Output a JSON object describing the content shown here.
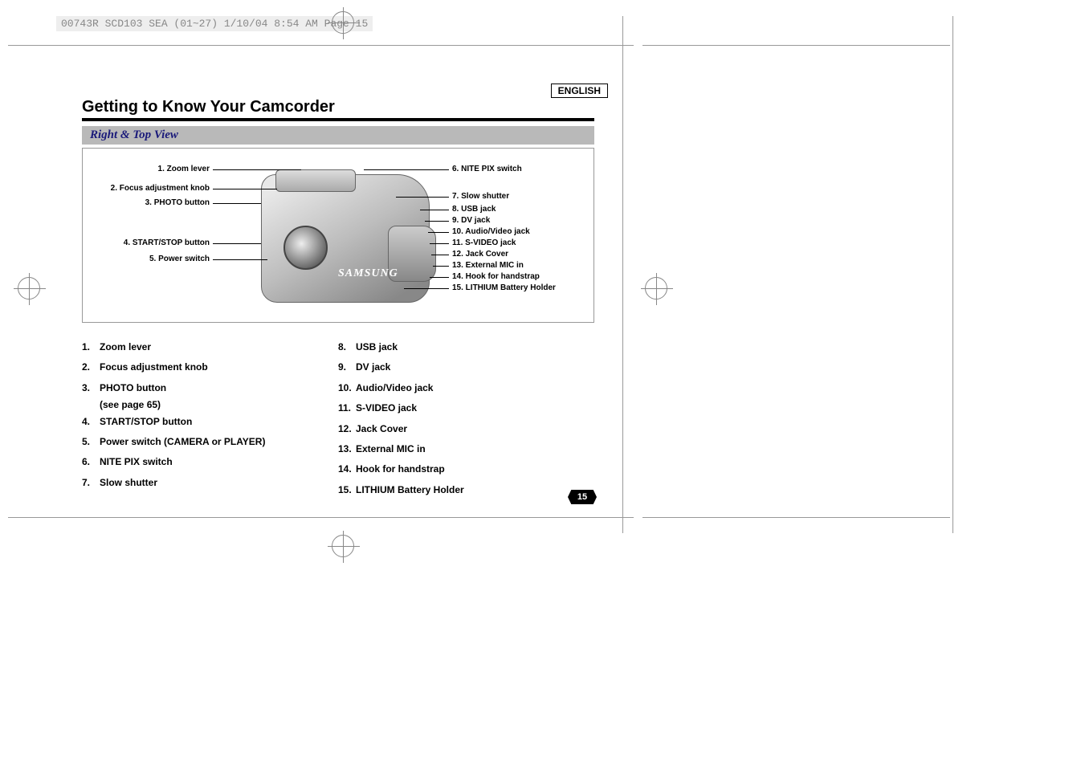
{
  "header_line": "00743R SCD103 SEA (01~27)  1/10/04 8:54 AM  Page 15",
  "language": "ENGLISH",
  "title": "Getting to Know Your Camcorder",
  "subtitle": "Right & Top View",
  "brand": "SAMSUNG",
  "callouts_left": [
    "1. Zoom lever",
    "2. Focus adjustment knob",
    "3. PHOTO button",
    "4. START/STOP button",
    "5. Power switch"
  ],
  "callouts_right": [
    "6. NITE PIX switch",
    "7. Slow shutter",
    "8. USB jack",
    "9. DV jack",
    "10. Audio/Video jack",
    "11. S-VIDEO jack",
    "12. Jack Cover",
    "13. External MIC in",
    "14. Hook for handstrap",
    "15. LITHIUM Battery Holder"
  ],
  "list_left": [
    {
      "n": "1.",
      "t": "Zoom lever"
    },
    {
      "n": "2.",
      "t": "Focus adjustment knob"
    },
    {
      "n": "3.",
      "t": "PHOTO button",
      "sub": "(see page 65)"
    },
    {
      "n": "4.",
      "t": "START/STOP button"
    },
    {
      "n": "5.",
      "t": "Power switch (CAMERA or PLAYER)"
    },
    {
      "n": "6.",
      "t": "NITE PIX switch"
    },
    {
      "n": "7.",
      "t": "Slow shutter"
    }
  ],
  "list_right": [
    {
      "n": "8.",
      "t": "USB jack"
    },
    {
      "n": "9.",
      "t": "DV jack"
    },
    {
      "n": "10.",
      "t": "Audio/Video jack"
    },
    {
      "n": "11.",
      "t": "S-VIDEO jack"
    },
    {
      "n": "12.",
      "t": "Jack Cover"
    },
    {
      "n": "13.",
      "t": "External MIC in"
    },
    {
      "n": "14.",
      "t": "Hook for handstrap"
    },
    {
      "n": "15.",
      "t": "LITHIUM Battery Holder"
    }
  ],
  "page_number": "15"
}
